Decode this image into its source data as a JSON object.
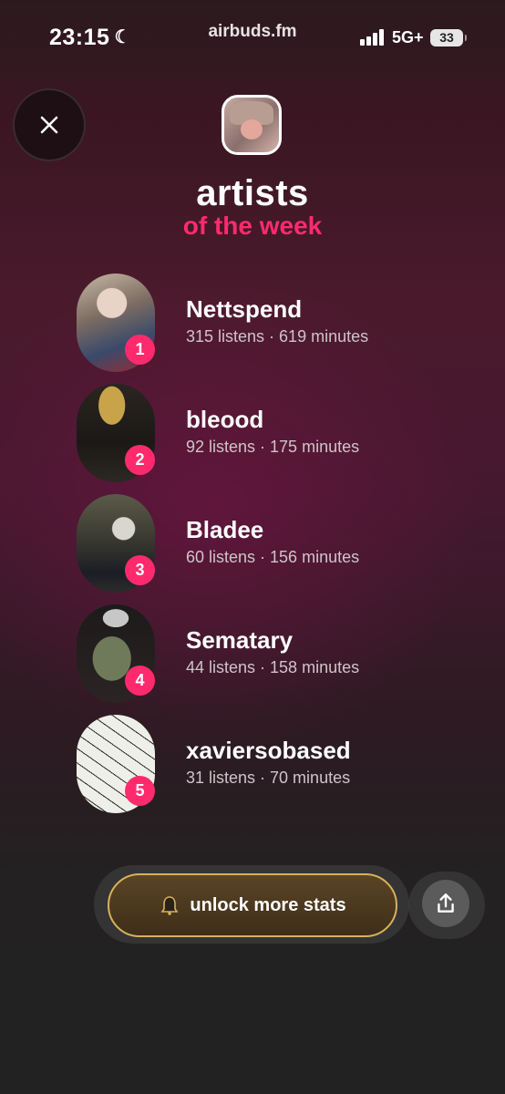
{
  "status_bar": {
    "time": "23:15",
    "url": "airbuds.fm",
    "network": "5G+",
    "battery": "33"
  },
  "header": {
    "title": "artists",
    "subtitle": "of the week"
  },
  "artists": [
    {
      "rank": "1",
      "name": "Nettspend",
      "stats": "315 listens · 619 minutes"
    },
    {
      "rank": "2",
      "name": "bleood",
      "stats": "92 listens · 175 minutes"
    },
    {
      "rank": "3",
      "name": "Bladee",
      "stats": "60 listens · 156 minutes"
    },
    {
      "rank": "4",
      "name": "Sematary",
      "stats": "44 listens · 158 minutes"
    },
    {
      "rank": "5",
      "name": "xaviersobased",
      "stats": "31 listens · 70 minutes"
    }
  ],
  "actions": {
    "unlock_label": "unlock more stats"
  },
  "icons": {
    "close": "close-icon",
    "moon": "moon-icon",
    "bell": "bell-icon",
    "share": "share-icon"
  },
  "colors": {
    "accent": "#ff2a6d",
    "gold": "#d7b25a"
  }
}
